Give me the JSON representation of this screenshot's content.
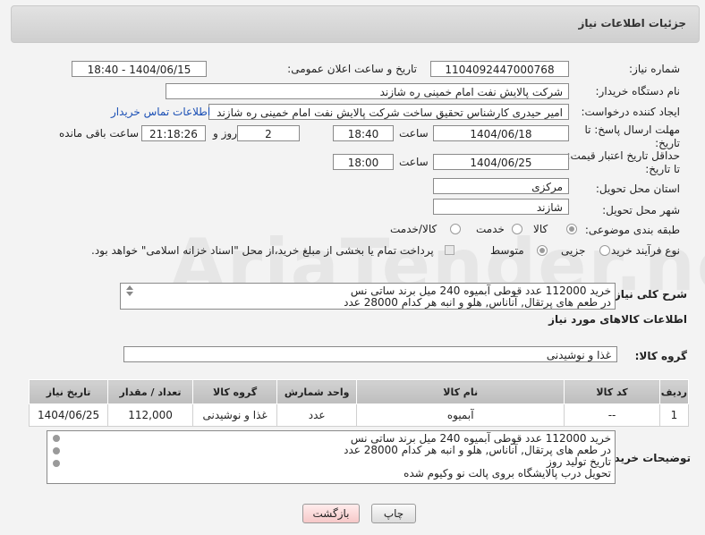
{
  "header": {
    "title": "جزئیات اطلاعات نیاز"
  },
  "form": {
    "need_number_label": "شماره نیاز:",
    "need_number": "1104092447000768",
    "announce_label": "تاریخ و ساعت اعلان عمومی:",
    "announce_value": "1404/06/15 - 18:40",
    "buyer_org_label": "نام دستگاه خریدار:",
    "buyer_org": "شرکت پالایش نفت امام خمینی  ره  شازند",
    "creator_label": "ایجاد کننده درخواست:",
    "creator": "امیر  حیدری کارشناس تحقیق ساخت شرکت پالایش نفت امام خمینی  ره  شازند",
    "contact_link": "اطلاعات تماس خریدار",
    "reply_deadline_label": "مهلت ارسال پاسخ: تا تاریخ:",
    "reply_date": "1404/06/18",
    "time_label": "ساعت",
    "reply_time": "18:40",
    "days_value": "2",
    "days_label": "روز و",
    "remaining_time": "21:18:26",
    "remaining_label": "ساعت باقی مانده",
    "price_validity_label": "حداقل تاریخ اعتبار قیمت: تا تاریخ:",
    "validity_date": "1404/06/25",
    "validity_time": "18:00",
    "province_label": "استان محل تحویل:",
    "province": "مرکزی",
    "city_label": "شهر محل تحویل:",
    "city": "شازند",
    "category_label": "طبقه بندی موضوعی:",
    "category_options": [
      "کالا",
      "خدمت",
      "کالا/خدمت"
    ],
    "process_label": "نوع فرآیند خرید :",
    "process_options": [
      "جزیی",
      "متوسط"
    ],
    "payment_note": "پرداخت تمام یا بخشی از مبلغ خرید،از محل \"اسناد خزانه اسلامی\" خواهد بود.",
    "summary_label": "شرح کلی نیاز:",
    "summary_lines": [
      "خرید 112000 عدد قوطی آبمیوه 240 میل برند ساتی نس",
      "در طعم های پرتقال, آناناس, هلو و انبه هر کدام 28000 عدد"
    ]
  },
  "goods": {
    "section_title": "اطلاعات کالاهای مورد نیاز",
    "group_label": "گروه کالا:",
    "group_value": "غذا و نوشیدنی",
    "columns": [
      "ردیف",
      "کد کالا",
      "نام کالا",
      "واحد شمارش",
      "گروه کالا",
      "تعداد / مقدار",
      "تاریخ نیاز"
    ],
    "rows": [
      {
        "row": "1",
        "code": "--",
        "name": "آبمیوه",
        "unit": "عدد",
        "group": "غذا و نوشیدنی",
        "qty": "112,000",
        "date": "1404/06/25"
      }
    ]
  },
  "buyer_notes": {
    "label": "توضیحات خریدار:",
    "lines": [
      "خرید 112000 عدد قوطی آبمیوه 240 میل برند ساتی نس",
      "در طعم های پرتقال, آناناس, هلو و انبه هر کدام 28000 عدد",
      "تاریخ تولید روز",
      "تحویل درب پالایشگاه بروی پالت نو وکیوم شده"
    ]
  },
  "buttons": {
    "print": "چاپ",
    "back": "بازگشت"
  },
  "watermark": "AriaTender.neT"
}
